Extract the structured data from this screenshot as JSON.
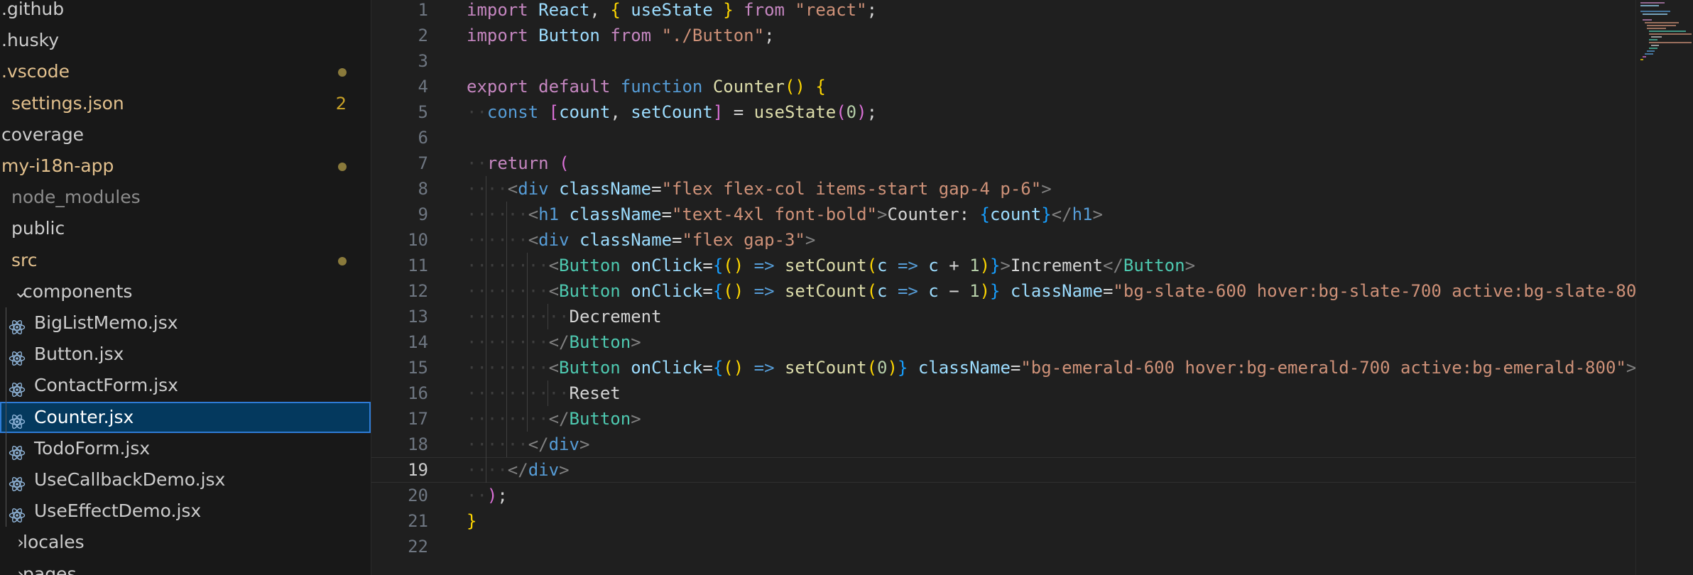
{
  "explorer": {
    "items": [
      {
        "label": ".github",
        "indent": 0,
        "chevron": "",
        "icon": "",
        "status": "",
        "badge": "",
        "selected": false
      },
      {
        "label": ".husky",
        "indent": 0,
        "chevron": "",
        "icon": "",
        "status": "",
        "badge": "",
        "selected": false
      },
      {
        "label": ".vscode",
        "indent": 0,
        "chevron": "",
        "icon": "",
        "status": "modified",
        "badge": "",
        "selected": false
      },
      {
        "label": "settings.json",
        "indent": 1,
        "chevron": "",
        "icon": "",
        "status": "modified",
        "badge": "2",
        "selected": false
      },
      {
        "label": "coverage",
        "indent": 0,
        "chevron": "",
        "icon": "",
        "status": "",
        "badge": "",
        "selected": false
      },
      {
        "label": "my-i18n-app",
        "indent": 0,
        "chevron": "",
        "icon": "",
        "status": "modified",
        "badge": "",
        "selected": false
      },
      {
        "label": "node_modules",
        "indent": 1,
        "chevron": "",
        "icon": "",
        "status": "ignored",
        "badge": "",
        "selected": false
      },
      {
        "label": "public",
        "indent": 1,
        "chevron": "",
        "icon": "",
        "status": "",
        "badge": "",
        "selected": false
      },
      {
        "label": "src",
        "indent": 1,
        "chevron": "",
        "icon": "",
        "status": "modified",
        "badge": "",
        "selected": false
      },
      {
        "label": "components",
        "indent": 2,
        "chevron": "⌄",
        "icon": "",
        "status": "",
        "badge": "",
        "selected": false
      },
      {
        "label": "BigListMemo.jsx",
        "indent": 3,
        "chevron": "",
        "icon": "react-icon",
        "status": "",
        "badge": "",
        "selected": false
      },
      {
        "label": "Button.jsx",
        "indent": 3,
        "chevron": "",
        "icon": "react-icon",
        "status": "",
        "badge": "",
        "selected": false
      },
      {
        "label": "ContactForm.jsx",
        "indent": 3,
        "chevron": "",
        "icon": "react-icon",
        "status": "",
        "badge": "",
        "selected": false
      },
      {
        "label": "Counter.jsx",
        "indent": 3,
        "chevron": "",
        "icon": "react-icon",
        "status": "",
        "badge": "",
        "selected": true
      },
      {
        "label": "TodoForm.jsx",
        "indent": 3,
        "chevron": "",
        "icon": "react-icon",
        "status": "",
        "badge": "",
        "selected": false
      },
      {
        "label": "UseCallbackDemo.jsx",
        "indent": 3,
        "chevron": "",
        "icon": "react-icon",
        "status": "",
        "badge": "",
        "selected": false
      },
      {
        "label": "UseEffectDemo.jsx",
        "indent": 3,
        "chevron": "",
        "icon": "react-icon",
        "status": "",
        "badge": "",
        "selected": false
      },
      {
        "label": "locales",
        "indent": 2,
        "chevron": "›",
        "icon": "",
        "status": "",
        "badge": "",
        "selected": false
      },
      {
        "label": "pages",
        "indent": 2,
        "chevron": "›",
        "icon": "",
        "status": "",
        "badge": "",
        "selected": false
      }
    ]
  },
  "editor": {
    "current_line": 19,
    "lines": [
      {
        "n": "1",
        "ind": 0,
        "tokens": [
          [
            "import",
            "kw"
          ],
          [
            " ",
            "ws"
          ],
          [
            "React",
            "var"
          ],
          [
            ", ",
            "plain"
          ],
          [
            "{",
            "b1"
          ],
          [
            " ",
            "ws"
          ],
          [
            "useState",
            "var"
          ],
          [
            " ",
            "ws"
          ],
          [
            "}",
            "b1"
          ],
          [
            " ",
            "ws"
          ],
          [
            "from",
            "kw"
          ],
          [
            " ",
            "ws"
          ],
          [
            "\"react\"",
            "str"
          ],
          [
            ";",
            "plain"
          ]
        ]
      },
      {
        "n": "2",
        "ind": 0,
        "tokens": [
          [
            "import",
            "kw"
          ],
          [
            " ",
            "ws"
          ],
          [
            "Button",
            "var"
          ],
          [
            " ",
            "ws"
          ],
          [
            "from",
            "kw"
          ],
          [
            " ",
            "ws"
          ],
          [
            "\"./Button\"",
            "str"
          ],
          [
            ";",
            "plain"
          ]
        ]
      },
      {
        "n": "3",
        "ind": 0,
        "tokens": []
      },
      {
        "n": "4",
        "ind": 0,
        "tokens": [
          [
            "export",
            "kw"
          ],
          [
            " ",
            "ws"
          ],
          [
            "default",
            "kw"
          ],
          [
            " ",
            "ws"
          ],
          [
            "function",
            "dec"
          ],
          [
            " ",
            "ws"
          ],
          [
            "Counter",
            "fn"
          ],
          [
            "()",
            "b1"
          ],
          [
            " ",
            "ws"
          ],
          [
            "{",
            "b1"
          ]
        ]
      },
      {
        "n": "5",
        "ind": 1,
        "tokens": [
          [
            "const",
            "dec"
          ],
          [
            " ",
            "ws"
          ],
          [
            "[",
            "b2"
          ],
          [
            "count",
            "var"
          ],
          [
            ", ",
            "plain"
          ],
          [
            "setCount",
            "var"
          ],
          [
            "]",
            "b2"
          ],
          [
            " ",
            "ws"
          ],
          [
            "=",
            "plain"
          ],
          [
            " ",
            "ws"
          ],
          [
            "useState",
            "fn"
          ],
          [
            "(",
            "b2"
          ],
          [
            "0",
            "num"
          ],
          [
            ")",
            "b2"
          ],
          [
            ";",
            "plain"
          ]
        ]
      },
      {
        "n": "6",
        "ind": 0,
        "tokens": []
      },
      {
        "n": "7",
        "ind": 1,
        "tokens": [
          [
            "return",
            "kw"
          ],
          [
            " ",
            "ws"
          ],
          [
            "(",
            "b2"
          ]
        ]
      },
      {
        "n": "8",
        "ind": 2,
        "tokens": [
          [
            "<",
            "tag"
          ],
          [
            "div",
            "dec"
          ],
          [
            " ",
            "ws"
          ],
          [
            "className",
            "var"
          ],
          [
            "=",
            "plain"
          ],
          [
            "\"flex flex-col items-start gap-4 p-6\"",
            "str"
          ],
          [
            ">",
            "tag"
          ]
        ]
      },
      {
        "n": "9",
        "ind": 3,
        "tokens": [
          [
            "<",
            "tag"
          ],
          [
            "h1",
            "dec"
          ],
          [
            " ",
            "ws"
          ],
          [
            "className",
            "var"
          ],
          [
            "=",
            "plain"
          ],
          [
            "\"text-4xl font-bold\"",
            "str"
          ],
          [
            ">",
            "tag"
          ],
          [
            "Counter: ",
            "plain"
          ],
          [
            "{",
            "b3"
          ],
          [
            "count",
            "var"
          ],
          [
            "}",
            "b3"
          ],
          [
            "</",
            "tag"
          ],
          [
            "h1",
            "dec"
          ],
          [
            ">",
            "tag"
          ]
        ]
      },
      {
        "n": "10",
        "ind": 3,
        "tokens": [
          [
            "<",
            "tag"
          ],
          [
            "div",
            "dec"
          ],
          [
            " ",
            "ws"
          ],
          [
            "className",
            "var"
          ],
          [
            "=",
            "plain"
          ],
          [
            "\"flex gap-3\"",
            "str"
          ],
          [
            ">",
            "tag"
          ]
        ]
      },
      {
        "n": "11",
        "ind": 4,
        "tokens": [
          [
            "<",
            "tag"
          ],
          [
            "Button",
            "comp"
          ],
          [
            " ",
            "ws"
          ],
          [
            "onClick",
            "var"
          ],
          [
            "=",
            "plain"
          ],
          [
            "{",
            "b3"
          ],
          [
            "()",
            "b1"
          ],
          [
            " ",
            "ws"
          ],
          [
            "=>",
            "dec"
          ],
          [
            " ",
            "ws"
          ],
          [
            "setCount",
            "fn"
          ],
          [
            "(",
            "b1"
          ],
          [
            "c",
            "var"
          ],
          [
            " ",
            "ws"
          ],
          [
            "=>",
            "dec"
          ],
          [
            " ",
            "ws"
          ],
          [
            "c",
            "var"
          ],
          [
            " ",
            "ws"
          ],
          [
            "+",
            "plain"
          ],
          [
            " ",
            "ws"
          ],
          [
            "1",
            "num"
          ],
          [
            ")",
            "b1"
          ],
          [
            "}",
            "b3"
          ],
          [
            ">",
            "tag"
          ],
          [
            "Increment",
            "plain"
          ],
          [
            "</",
            "tag"
          ],
          [
            "Button",
            "comp"
          ],
          [
            ">",
            "tag"
          ]
        ]
      },
      {
        "n": "12",
        "ind": 4,
        "tokens": [
          [
            "<",
            "tag"
          ],
          [
            "Button",
            "comp"
          ],
          [
            " ",
            "ws"
          ],
          [
            "onClick",
            "var"
          ],
          [
            "=",
            "plain"
          ],
          [
            "{",
            "b3"
          ],
          [
            "()",
            "b1"
          ],
          [
            " ",
            "ws"
          ],
          [
            "=>",
            "dec"
          ],
          [
            " ",
            "ws"
          ],
          [
            "setCount",
            "fn"
          ],
          [
            "(",
            "b1"
          ],
          [
            "c",
            "var"
          ],
          [
            " ",
            "ws"
          ],
          [
            "=>",
            "dec"
          ],
          [
            " ",
            "ws"
          ],
          [
            "c",
            "var"
          ],
          [
            " ",
            "ws"
          ],
          [
            "−",
            "plain"
          ],
          [
            " ",
            "ws"
          ],
          [
            "1",
            "num"
          ],
          [
            ")",
            "b1"
          ],
          [
            "}",
            "b3"
          ],
          [
            " ",
            "ws"
          ],
          [
            "className",
            "var"
          ],
          [
            "=",
            "plain"
          ],
          [
            "\"bg-slate-600 hover:bg-slate-700 active:bg-slate-80",
            "str"
          ]
        ]
      },
      {
        "n": "13",
        "ind": 5,
        "tokens": [
          [
            "Decrement",
            "plain"
          ]
        ]
      },
      {
        "n": "14",
        "ind": 4,
        "tokens": [
          [
            "</",
            "tag"
          ],
          [
            "Button",
            "comp"
          ],
          [
            ">",
            "tag"
          ]
        ]
      },
      {
        "n": "15",
        "ind": 4,
        "tokens": [
          [
            "<",
            "tag"
          ],
          [
            "Button",
            "comp"
          ],
          [
            " ",
            "ws"
          ],
          [
            "onClick",
            "var"
          ],
          [
            "=",
            "plain"
          ],
          [
            "{",
            "b3"
          ],
          [
            "()",
            "b1"
          ],
          [
            " ",
            "ws"
          ],
          [
            "=>",
            "dec"
          ],
          [
            " ",
            "ws"
          ],
          [
            "setCount",
            "fn"
          ],
          [
            "(",
            "b1"
          ],
          [
            "0",
            "num"
          ],
          [
            ")",
            "b1"
          ],
          [
            "}",
            "b3"
          ],
          [
            " ",
            "ws"
          ],
          [
            "className",
            "var"
          ],
          [
            "=",
            "plain"
          ],
          [
            "\"bg-emerald-600 hover:bg-emerald-700 active:bg-emerald-800\"",
            "str"
          ],
          [
            ">",
            "tag"
          ]
        ]
      },
      {
        "n": "16",
        "ind": 5,
        "tokens": [
          [
            "Reset",
            "plain"
          ]
        ]
      },
      {
        "n": "17",
        "ind": 4,
        "tokens": [
          [
            "</",
            "tag"
          ],
          [
            "Button",
            "comp"
          ],
          [
            ">",
            "tag"
          ]
        ]
      },
      {
        "n": "18",
        "ind": 3,
        "tokens": [
          [
            "</",
            "tag"
          ],
          [
            "div",
            "dec"
          ],
          [
            ">",
            "tag"
          ]
        ]
      },
      {
        "n": "19",
        "ind": 2,
        "tokens": [
          [
            "</",
            "tag"
          ],
          [
            "div",
            "dec"
          ],
          [
            ">",
            "tag"
          ]
        ]
      },
      {
        "n": "20",
        "ind": 1,
        "tokens": [
          [
            ")",
            "b2"
          ],
          [
            ";",
            "plain"
          ]
        ]
      },
      {
        "n": "21",
        "ind": 0,
        "tokens": [
          [
            "}",
            "b1"
          ]
        ]
      },
      {
        "n": "22",
        "ind": 0,
        "tokens": []
      }
    ]
  },
  "colors": {
    "selection_bg": "#04395e",
    "selection_border": "#2e7bd6",
    "modified": "#e2c08d",
    "editor_bg": "#1f1f1f",
    "sidebar_bg": "#181818"
  }
}
